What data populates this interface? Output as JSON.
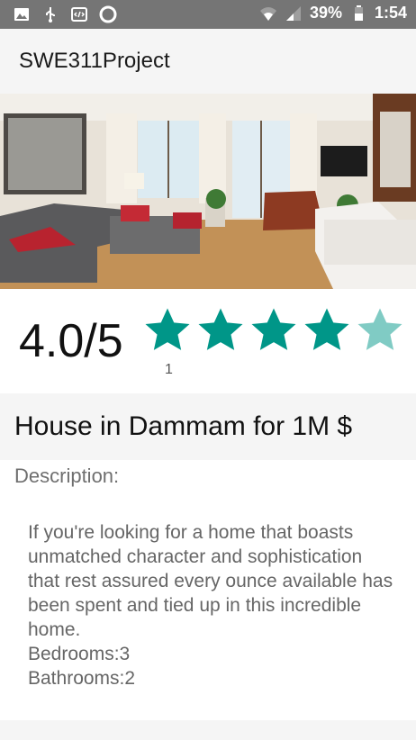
{
  "status_bar": {
    "battery_percent": "39%",
    "time": "1:54",
    "left_icons": [
      "image-icon",
      "usb-icon",
      "code-icon",
      "circle-icon"
    ],
    "right_icons": [
      "wifi-icon",
      "signal-icon",
      "battery-icon"
    ]
  },
  "app_bar": {
    "title": "SWE311Project"
  },
  "rating": {
    "value": "4.0/5",
    "count": "1",
    "stars_filled": 4,
    "stars_total": 5,
    "star_color": "#009688",
    "star_empty_color": "#80cbc4"
  },
  "listing": {
    "title": "House in Dammam for 1M $",
    "description_label": "Description:",
    "description": "If you're looking for a home that boasts unmatched character and sophistication that rest assured every ounce available has been spent and tied up in this incredible home.\nBedrooms:3\nBathrooms:2"
  }
}
